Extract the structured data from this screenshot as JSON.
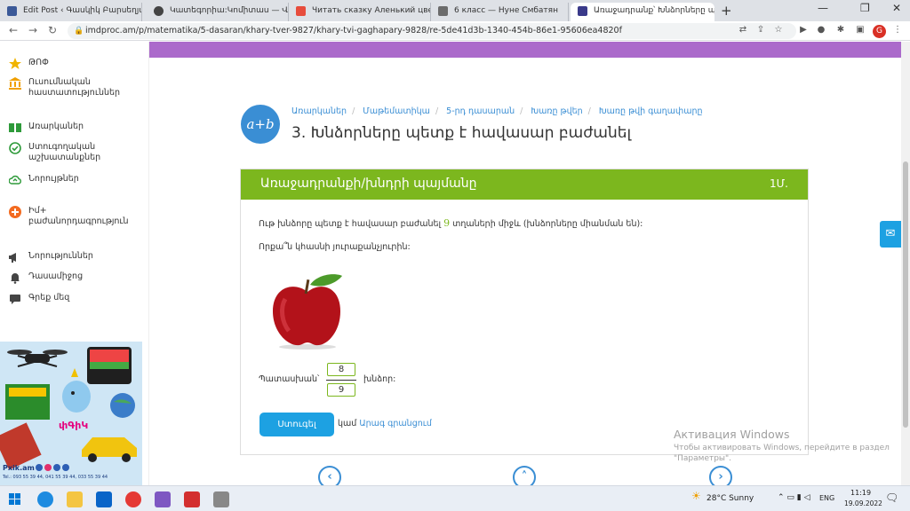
{
  "browser": {
    "tabs": [
      {
        "title": "Edit Post ‹ Գասկիկ Բարսեղյան",
        "active": false
      },
      {
        "title": "Կատեգորիա:Կոմիտաս — Վիքի",
        "active": false
      },
      {
        "title": "Читать сказку Аленький цвето",
        "active": false
      },
      {
        "title": "6 класс — Нуне Смбатян",
        "active": false
      },
      {
        "title": "Առաջադրանք՝ Խնձորները պե",
        "active": true
      }
    ],
    "url": "imdproc.am/p/matematika/5-dasaran/khary-tver-9827/khary-tvi-gaghapary-9828/re-5de41d3b-1340-454b-86e1-95606ea4820f",
    "profile_initial": "G"
  },
  "sidebar": {
    "items": [
      {
        "label": "ԹՈՓ",
        "icon": "star-icon"
      },
      {
        "label": "Ուսումնական հաստատություններ",
        "icon": "institution-icon"
      },
      {
        "label": "Առարկաներ",
        "icon": "book-icon"
      },
      {
        "label": "Ստուգողական աշխատանքներ",
        "icon": "check-icon"
      },
      {
        "label": "Նորույթներ",
        "icon": "cloud-upload-icon"
      },
      {
        "label": "Իմ+ բաժանորդագրություն",
        "icon": "plus-badge-icon"
      },
      {
        "label": "Նորություններ",
        "icon": "megaphone-icon"
      },
      {
        "label": "Դասամիջոց",
        "icon": "bell-icon"
      },
      {
        "label": "Գրեք մեզ",
        "icon": "chat-icon"
      }
    ],
    "ad": {
      "brand": "փԳիԿ",
      "site": "Pxik.am",
      "phones": "Tel.: 093 55 39 44, 041 55 39 44, 033 55 39 44"
    }
  },
  "lesson": {
    "badge": "a+b",
    "breadcrumbs": [
      "Առարկաներ",
      "Մաթեմատիկա",
      "5-րդ դասարան",
      "Խառը թվեր",
      "Խառը թվի գաղափարը"
    ],
    "title": "3. Խնձորները պետք է հավասար բաժանել"
  },
  "task": {
    "header": "Առաջադրանքի/խնդրի պայմանը",
    "points": "1Մ.",
    "statement_before": "Ութ խնձորը պետք է հավասար բաժանել ",
    "statement_number": "9",
    "statement_after": " տղաների միջև (խնձորները միանման են):",
    "question": "Որքա՞ն կհասնի յուրաքանչյուրին:",
    "answer_label": "Պատասխան՝",
    "numerator": "8",
    "denominator": "9",
    "answer_unit": "խնձոր:",
    "submit_label": "Ստուգել",
    "or_text": "կամ",
    "quick_link": "Արագ գրանցում"
  },
  "activation": {
    "title": "Активация Windows",
    "subtitle_1": "Чтобы активировать Windows, перейдите в раздел",
    "subtitle_2": "\"Параметры\"."
  },
  "taskbar": {
    "weather": "28°C Sunny",
    "language": "ENG",
    "time": "11:19",
    "date": "19.09.2022"
  },
  "colors": {
    "green_header": "#7cb71e",
    "accent_blue": "#3a8ed4",
    "purple_bar": "#ab6acb"
  }
}
